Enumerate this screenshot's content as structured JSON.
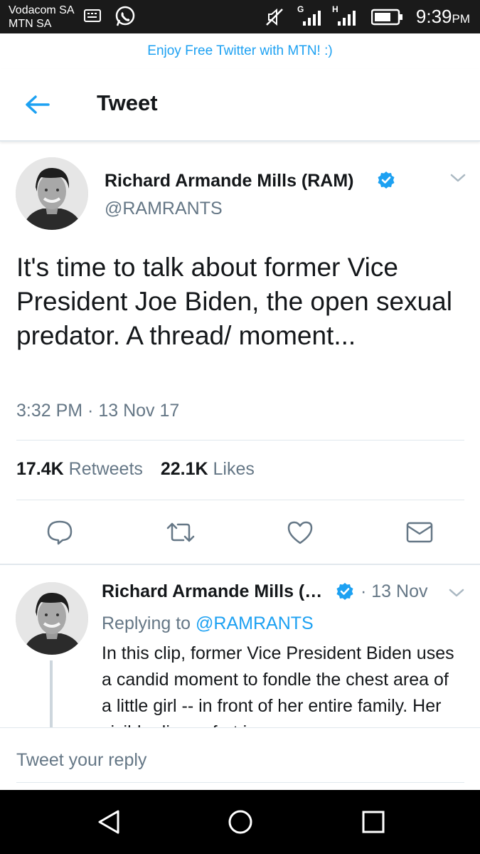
{
  "status_bar": {
    "carrier_line1": "Vodacom SA",
    "carrier_line2": "MTN SA",
    "time": "9:39",
    "time_suffix": "PM",
    "network_label_1": "G",
    "network_label_2": "H"
  },
  "banner": {
    "text": "Enjoy Free Twitter with MTN! :)"
  },
  "header": {
    "title": "Tweet"
  },
  "tweet": {
    "author_name": "Richard Armande Mills (RAM)",
    "handle": "@RAMRANTS",
    "text": "It's time to talk about former Vice President Joe Biden, the open sexual predator. A thread/ moment...",
    "timestamp": "3:32 PM · 13 Nov 17",
    "retweets_count": "17.4K",
    "retweets_label": "Retweets",
    "likes_count": "22.1K",
    "likes_label": "Likes"
  },
  "reply_tweet": {
    "author_name": "Richard Armande Mills (…",
    "date": "· 13 Nov",
    "replying_prefix": "Replying to",
    "replying_to": "@RAMRANTS",
    "text": "In this clip, former Vice President Biden uses a candid moment to fondle the chest area of a little girl -- in front of her entire family. Her visible discomfort is"
  },
  "composer": {
    "placeholder": "Tweet your reply"
  },
  "colors": {
    "accent": "#1da1f2",
    "secondary_text": "#657786",
    "primary_text": "#14171a",
    "divider": "#e1e8ed",
    "status_bar": "#1a1a1a",
    "nav_bar": "#000000"
  },
  "icons": {
    "back": "arrow-left-icon",
    "verified": "verified-badge-icon",
    "menu": "chevron-down-icon",
    "reply": "reply-icon",
    "retweet": "retweet-icon",
    "like": "heart-icon",
    "message": "envelope-icon",
    "nav_back": "triangle-back-icon",
    "nav_home": "circle-home-icon",
    "nav_recent": "square-recent-icon"
  }
}
